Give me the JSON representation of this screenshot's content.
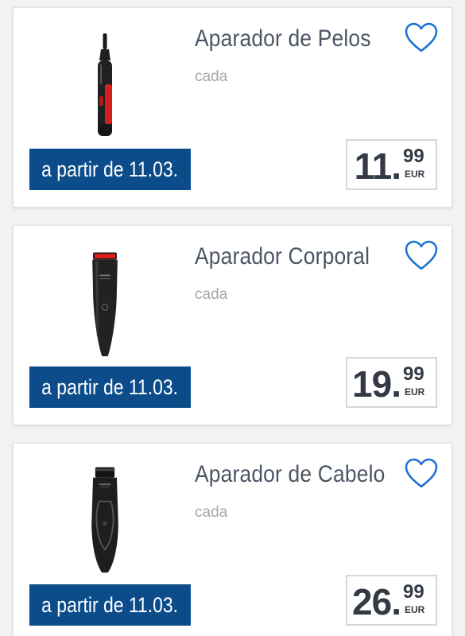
{
  "products": [
    {
      "title": "Aparador de Pelos",
      "unit": "cada",
      "availability": "a partir de 11.03.",
      "price_int": "11.",
      "price_dec": "99",
      "currency": "EUR",
      "image": "nose-trimmer-image"
    },
    {
      "title": "Aparador Corporal",
      "unit": "cada",
      "availability": "a partir de 11.03.",
      "price_int": "19.",
      "price_dec": "99",
      "currency": "EUR",
      "image": "body-trimmer-image"
    },
    {
      "title": "Aparador de Cabelo",
      "unit": "cada",
      "availability": "a partir de 11.03.",
      "price_int": "26.",
      "price_dec": "99",
      "currency": "EUR",
      "image": "hair-clipper-image"
    }
  ],
  "colors": {
    "badge_bg": "#0c4c8a",
    "favorite_icon": "#1a6fd1",
    "title": "#4b5563",
    "price": "#333a44"
  },
  "icons": {
    "favorite": "heart-outline-icon"
  }
}
